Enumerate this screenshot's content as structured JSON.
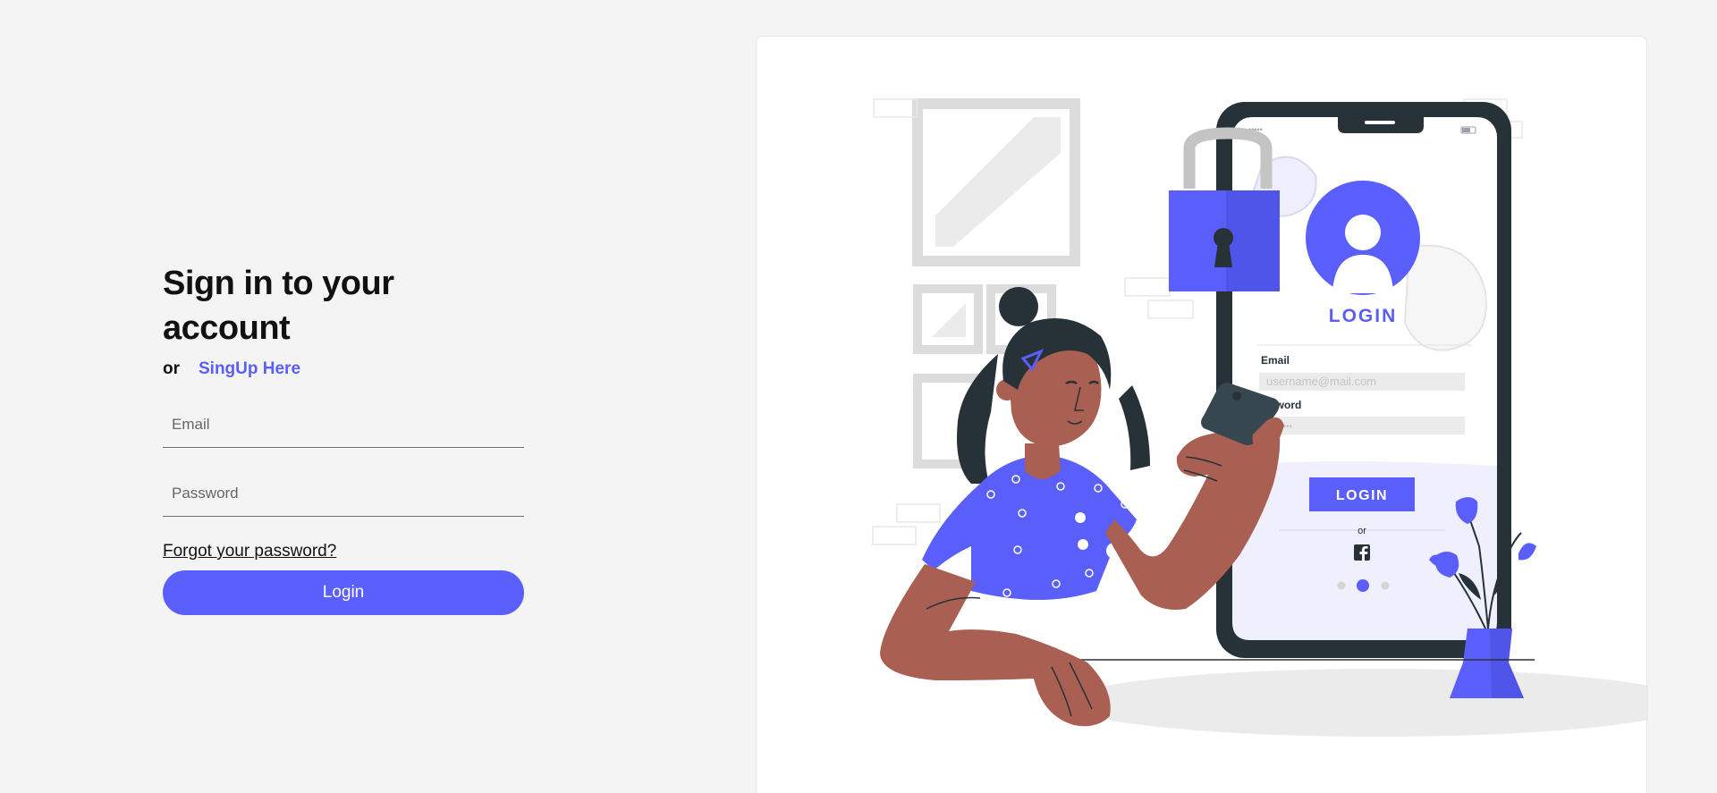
{
  "form": {
    "title": "Sign in to your account",
    "or_text": "or",
    "signup_link": "SingUp Here",
    "email_placeholder": "Email",
    "password_placeholder": "Password",
    "forgot_link": "Forgot your password?",
    "login_button": "Login"
  },
  "illustration": {
    "login_heading": "LOGIN",
    "email_label": "Email",
    "email_placeholder": "username@mail.com",
    "password_label": "sword",
    "password_mask": "••••••",
    "login_button": "LOGIN",
    "or_text": "or",
    "social_icon": "facebook-icon",
    "carousel_dots": 3,
    "carousel_active": 2
  },
  "colors": {
    "accent": "#5a5ffb",
    "background": "#f4f4f4",
    "card": "#ffffff",
    "phone_frame": "#263238",
    "skin": "#a95f52"
  }
}
